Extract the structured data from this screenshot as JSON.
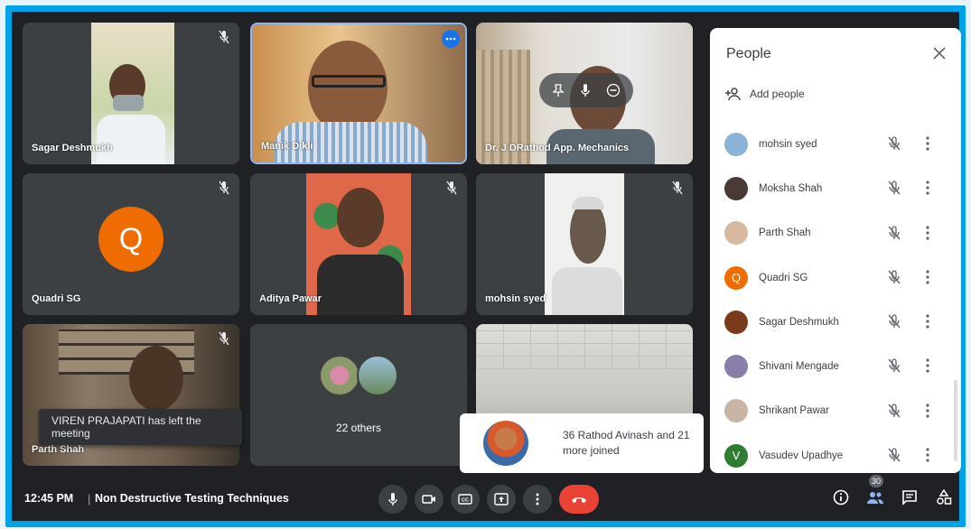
{
  "tiles": {
    "t1": {
      "name": "Sagar Deshmukh"
    },
    "t2": {
      "name": "Manik Dikli"
    },
    "t3": {
      "name": "Dr. J DRathod App. Mechanics"
    },
    "t4": {
      "name": "Quadri SG",
      "initial": "Q"
    },
    "t5": {
      "name": "Aditya Pawar"
    },
    "t6": {
      "name": "mohsin syed"
    },
    "t7": {
      "name": "Parth Shah"
    },
    "t8": {
      "others_label": "22 others"
    },
    "t9": {
      "name": ""
    }
  },
  "toast": {
    "text": "VIREN PRAJAPATI has left the meeting"
  },
  "joined": {
    "text": "36 Rathod Avinash and 21 more joined"
  },
  "people_panel": {
    "title": "People",
    "add_people": "Add people",
    "participants": [
      {
        "name": "mohsin syed",
        "avatar_color": "#8bb3d8"
      },
      {
        "name": "Moksha Shah",
        "avatar_color": "#4a3a36"
      },
      {
        "name": "Parth Shah",
        "avatar_color": "#d9b8a0"
      },
      {
        "name": "Quadri SG",
        "avatar_color": "#ef6c00",
        "initial": "Q"
      },
      {
        "name": "Sagar Deshmukh",
        "avatar_color": "#7a3b1c"
      },
      {
        "name": "Shivani Mengade",
        "avatar_color": "#8a7fa8"
      },
      {
        "name": "Shrikant Pawar",
        "avatar_color": "#c9b5a5"
      },
      {
        "name": "Vasudev Upadhye",
        "avatar_color": "#2e7d32",
        "initial": "V"
      }
    ]
  },
  "bottom_bar": {
    "time": "12:45 PM",
    "separator": "|",
    "meeting_title": "Non Destructive Testing Techniques",
    "participant_count": "30"
  },
  "colors": {
    "accent": "#1a73e8",
    "end_call": "#ea4335",
    "quadri": "#ef6c00",
    "frame": "#00a2e8"
  }
}
